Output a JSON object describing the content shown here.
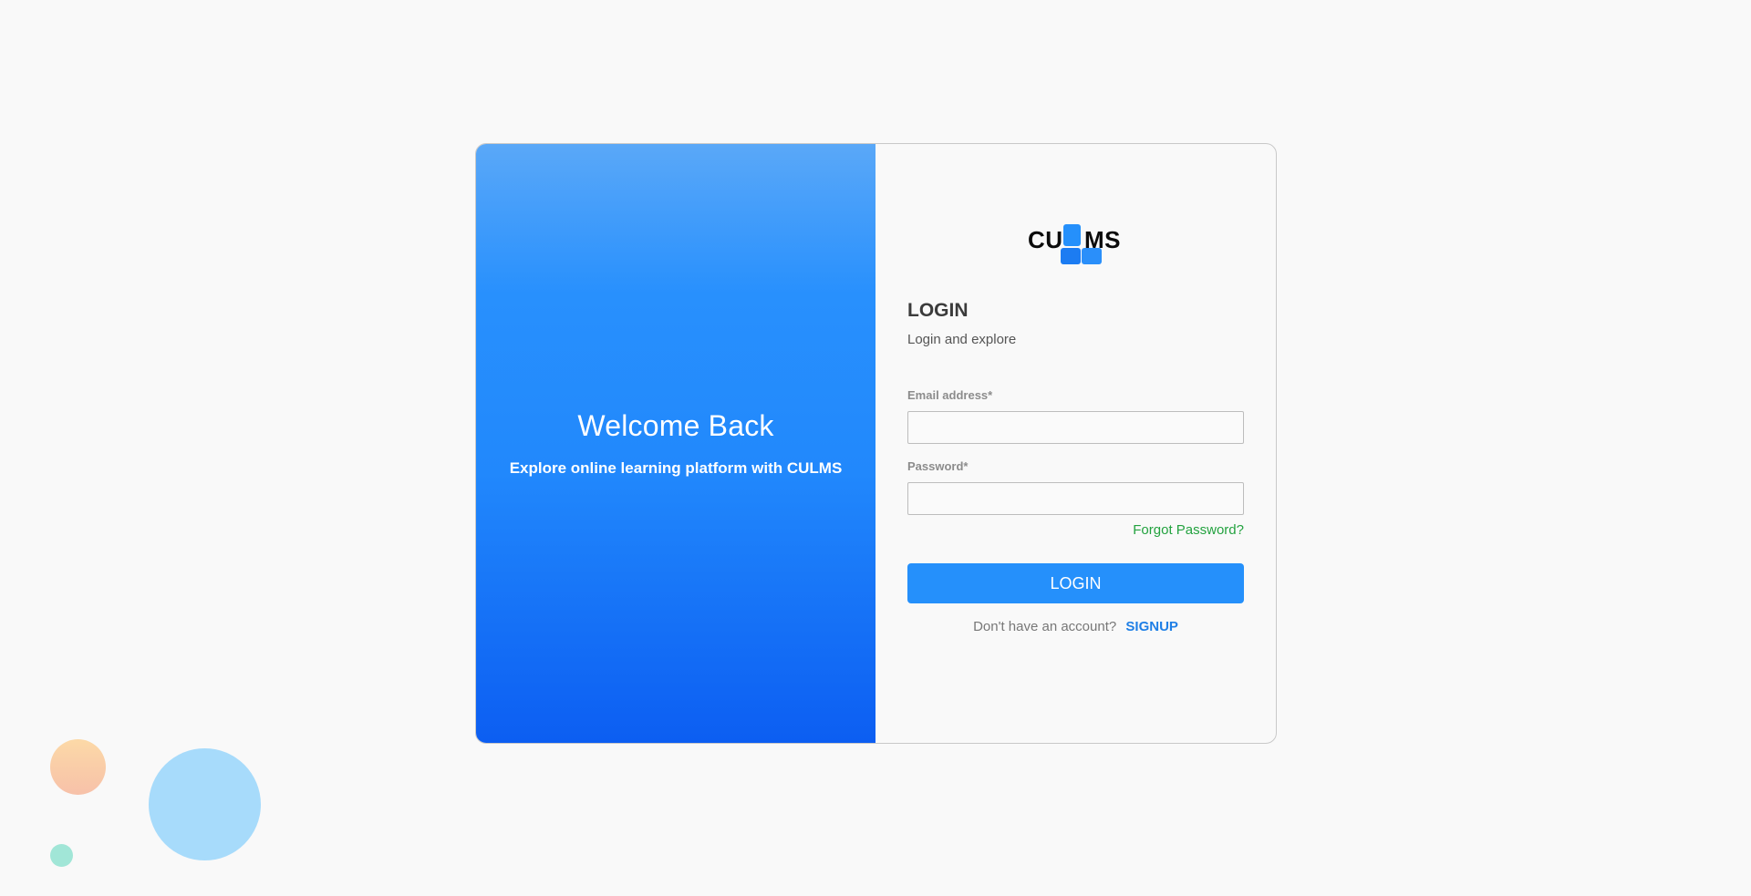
{
  "hero": {
    "title": "Welcome Back",
    "subtitle": "Explore online learning platform with CULMS"
  },
  "logo": {
    "left_text": "CU",
    "right_text": "MS",
    "accent_color": "#2590fb"
  },
  "form": {
    "heading": "LOGIN",
    "subheading": "Login and explore",
    "email_label": "Email address*",
    "email_value": "",
    "password_label": "Password*",
    "password_value": "",
    "forgot_label": "Forgot Password?",
    "submit_label": "LOGIN",
    "signup_prompt": "Don't have an account?",
    "signup_label": "SIGNUP"
  },
  "colors": {
    "primary": "#2590fb",
    "link_green": "#23a23f",
    "signup_blue": "#1f7fe6",
    "background": "#f9f9f9"
  }
}
